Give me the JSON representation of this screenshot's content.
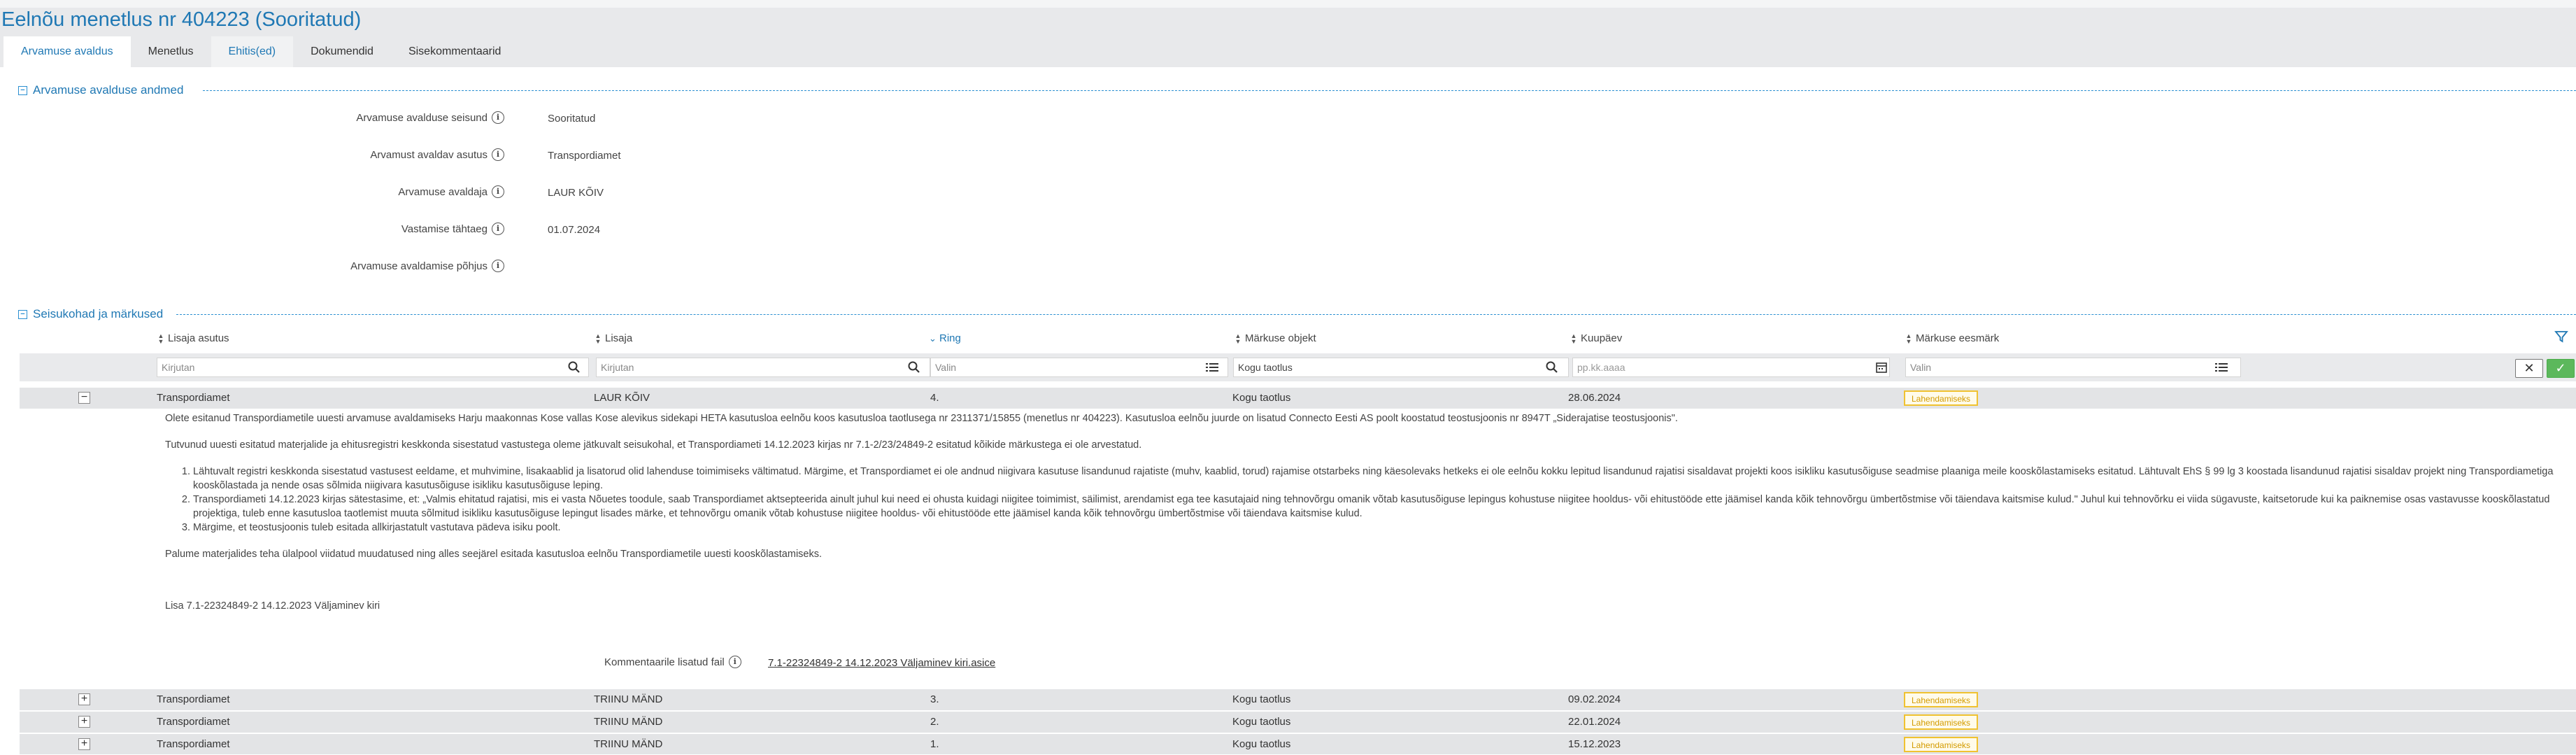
{
  "page_title": "Eelnõu menetlus nr 404223 (Sooritatud)",
  "tabs": [
    {
      "label": "Arvamuse avaldus"
    },
    {
      "label": "Menetlus"
    },
    {
      "label": "Ehitis(ed)"
    },
    {
      "label": "Dokumendid"
    },
    {
      "label": "Sisekommentaarid"
    }
  ],
  "section1": {
    "title": "Arvamuse avalduse andmed",
    "fields": [
      {
        "label": "Arvamuse avalduse seisund",
        "value": "Sooritatud"
      },
      {
        "label": "Arvamust avaldav asutus",
        "value": "Transpordiamet"
      },
      {
        "label": "Arvamuse avaldaja",
        "value": "LAUR KÕIV"
      },
      {
        "label": "Vastamise tähtaeg",
        "value": "01.07.2024"
      },
      {
        "label": "Arvamuse avaldamise põhjus",
        "value": ""
      }
    ]
  },
  "section2": {
    "title": "Seisukohad ja märkused",
    "columns": [
      "Lisaja asutus",
      "Lisaja",
      "Ring",
      "Märkuse objekt",
      "Kuupäev",
      "Märkuse eesmärk"
    ],
    "filters": {
      "lisaja_asutus": "Kirjutan",
      "lisaja": "Kirjutan",
      "ring": "Valin",
      "markuse_objekt": "Kogu taotlus",
      "kuupaev": "pp.kk.aaaa",
      "eesmark": "Valin"
    }
  },
  "rows": [
    {
      "asutus": "Transpordiamet",
      "lisaja": "LAUR KÕIV",
      "ring": "4.",
      "objekt": "Kogu taotlus",
      "kuupaev": "28.06.2024",
      "eesmark": "Lahendamiseks",
      "toggle": "−"
    },
    {
      "asutus": "Transpordiamet",
      "lisaja": "TRIINU MÄND",
      "ring": "3.",
      "objekt": "Kogu taotlus",
      "kuupaev": "09.02.2024",
      "eesmark": "Lahendamiseks",
      "toggle": "+"
    },
    {
      "asutus": "Transpordiamet",
      "lisaja": "TRIINU MÄND",
      "ring": "2.",
      "objekt": "Kogu taotlus",
      "kuupaev": "22.01.2024",
      "eesmark": "Lahendamiseks",
      "toggle": "+"
    },
    {
      "asutus": "Transpordiamet",
      "lisaja": "TRIINU MÄND",
      "ring": "1.",
      "objekt": "Kogu taotlus",
      "kuupaev": "15.12.2023",
      "eesmark": "Lahendamiseks",
      "toggle": "+"
    }
  ],
  "detail": {
    "para1": "Olete esitanud Transpordiametile uuesti arvamuse avaldamiseks Harju maakonnas Kose vallas Kose alevikus sidekapi HETA kasutusloa eelnõu koos kasutusloa taotlusega nr 2311371/15855 (menetlus nr 404223). Kasutusloa eelnõu juurde on lisatud Connecto Eesti AS poolt koostatud teostusjoonis nr 8947T „Siderajatise teostusjoonis\".",
    "para2": "Tutvunud uuesti esitatud materjalide ja ehitusregistri keskkonda sisestatud vastustega oleme jätkuvalt seisukohal, et Transpordiameti 14.12.2023 kirjas nr 7.1-2/23/24849-2 esitatud kõikide märkustega ei ole arvestatud.",
    "items": [
      "Lähtuvalt registri keskkonda sisestatud vastusest eeldame, et muhvimine, lisakaablid ja lisatorud olid lahenduse toimimiseks vältimatud. Märgime, et Transpordiamet ei ole andnud niigivara kasutuse lisandunud rajatiste (muhv, kaablid, torud) rajamise otstarbeks ning käesolevaks hetkeks ei ole eelnõu kokku lepitud lisandunud rajatisi sisaldavat projekti koos isikliku kasutusõiguse seadmise plaaniga meile kooskõlastamiseks esitatud. Lähtuvalt EhS § 99 lg 3 koostada lisandunud rajatisi sisaldav projekt ning Transpordiametiga kooskõlastada ja nende osas sõlmida niigivara kasutusõiguse isikliku kasutusõiguse leping.",
      "Transpordiameti 14.12.2023 kirjas sätestasime, et: „Valmis ehitatud rajatisi, mis ei vasta Nõuetes toodule, saab Transpordiamet aktsepteerida ainult juhul kui need ei ohusta kuidagi niigitee toimimist, säilimist, arendamist ega tee kasutajaid ning tehnovõrgu omanik võtab kasutusõiguse lepingus kohustuse niigitee hooldus- või ehitustööde ette jäämisel kanda kõik tehnovõrgu ümbertõstmise või täiendava kaitsmise kulud.\" Juhul kui tehnovõrku ei viida sügavuste, kaitsetorude kui ka paiknemise osas vastavusse kooskõlastatud projektiga, tuleb enne kasutusloa taotlemist muuta sõlmitud isikliku kasutusõiguse lepingut lisades märke, et tehnovõrgu omanik võtab kohustuse niigitee hooldus- või ehitustööde ette jäämisel kanda kõik tehnovõrgu ümbertõstmise või täiendava kaitsmise kulud.",
      "Märgime, et teostusjoonis tuleb esitada allkirjastatult vastutava pädeva isiku poolt."
    ],
    "para3": "Palume materjalides teha ülalpool viidatud muudatused ning alles seejärel esitada kasutusloa eelnõu Transpordiametile uuesti kooskõlastamiseks.",
    "lisa": "Lisa 7.1-22324849-2 14.12.2023 Väljaminev kiri",
    "file_label": "Kommentaarile lisatud fail",
    "file_link": "7.1-22324849-2 14.12.2023 Väljaminev kiri.asice"
  },
  "icons": {
    "section_toggle": "minus-square-icon",
    "info": "info-circle-icon",
    "search": "search-icon",
    "list": "list-icon",
    "calendar": "calendar-icon",
    "filter": "filter-icon",
    "clear": "close-icon",
    "apply": "check-icon"
  },
  "colors": {
    "accent": "#1f78b4",
    "badge_border": "#f0c230",
    "apply_button": "#5cb85c"
  }
}
